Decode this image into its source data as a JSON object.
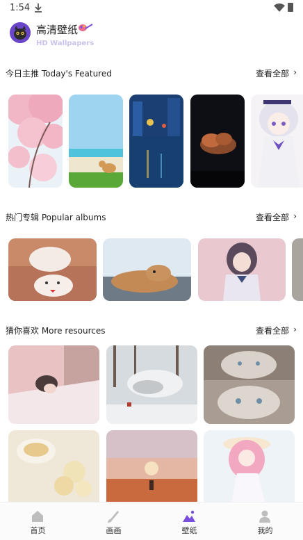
{
  "status_bar": {
    "time": "1:54"
  },
  "header": {
    "title": "高清壁纸",
    "subtitle": "HD Wallpapers",
    "logo_icon": "cat-avatar-icon",
    "brush_icon": "paint-brush-icon"
  },
  "sections": {
    "featured": {
      "title": "今日主推  Today's Featured",
      "more": "查看全部",
      "chevron": "›"
    },
    "albums": {
      "title": "热门专辑  Popular albums",
      "more": "查看全部",
      "chevron": "›"
    },
    "resources": {
      "title": "猜你喜欢  More resources",
      "more": "查看全部",
      "chevron": "›"
    }
  },
  "featured_items": [
    "cherry-blossom",
    "beach-dog",
    "rainy-city-night",
    "cloud-sunset",
    "anime-girl"
  ],
  "album_items": [
    "white-cat",
    "sleeping-dog",
    "anime-schoolgirl"
  ],
  "resource_items": [
    "girl-lying-bed",
    "dog-in-snow",
    "cats-collage",
    "tea-flowers",
    "sunset-dog",
    "anime-girl-hat"
  ],
  "bottom_nav": [
    {
      "label": "首页",
      "icon": "home-icon",
      "active": false
    },
    {
      "label": "画画",
      "icon": "brush-icon",
      "active": false
    },
    {
      "label": "壁纸",
      "icon": "wallpaper-mountain-icon",
      "active": true
    },
    {
      "label": "我的",
      "icon": "person-icon",
      "active": false
    }
  ],
  "colors": {
    "accent": "#7a4fdc",
    "subtitle": "#c9c2ec"
  }
}
